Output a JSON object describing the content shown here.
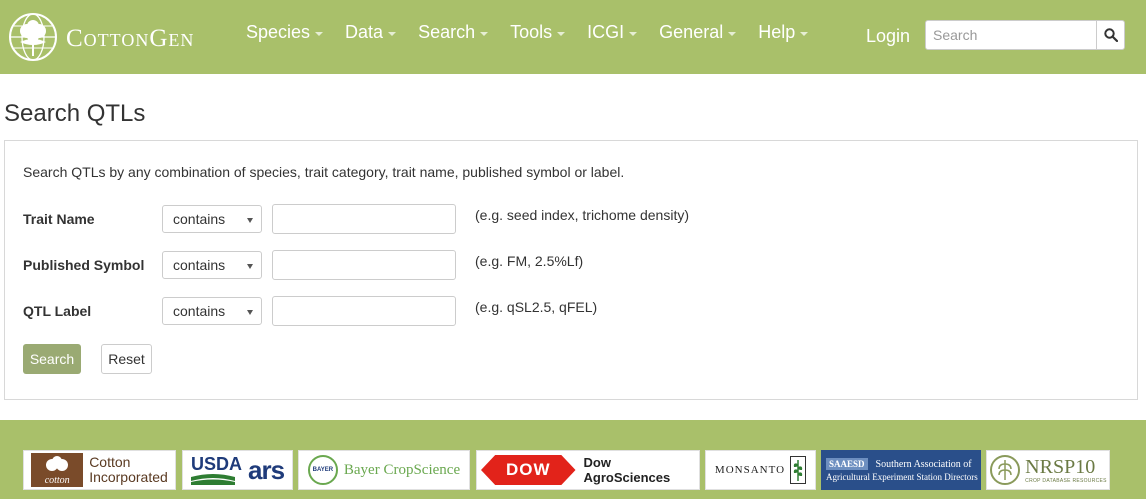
{
  "header": {
    "site_name": "CottonGen",
    "nav": [
      {
        "label": "Species"
      },
      {
        "label": "Data"
      },
      {
        "label": "Search"
      },
      {
        "label": "Tools"
      },
      {
        "label": "ICGI"
      },
      {
        "label": "General"
      },
      {
        "label": "Help"
      }
    ],
    "login_label": "Login",
    "search_placeholder": "Search"
  },
  "page": {
    "title": "Search QTLs",
    "description": "Search QTLs by any combination of species, trait category, trait name, published symbol or label.",
    "rows": [
      {
        "label": "Trait Name",
        "operator": "contains",
        "value": "",
        "example": "(e.g. seed index, trichome density)"
      },
      {
        "label": "Published Symbol",
        "operator": "contains",
        "value": "",
        "example": "(e.g. FM, 2.5%Lf)"
      },
      {
        "label": "QTL Label",
        "operator": "contains",
        "value": "",
        "example": "(e.g. qSL2.5, qFEL)"
      }
    ],
    "search_button": "Search",
    "reset_button": "Reset"
  },
  "footer": {
    "sponsors": {
      "cotton_inc": {
        "line1": "Cotton",
        "line2": "Incorporated",
        "badge": "cotton"
      },
      "usda": {
        "line1": "USDA",
        "line2": "ars"
      },
      "bayer": {
        "badge": "BAYER",
        "label": "Bayer CropScience"
      },
      "dow": {
        "badge": "DOW",
        "label": "Dow AgroSciences"
      },
      "monsanto": {
        "label": "MONSANTO"
      },
      "saaesd": {
        "badge": "SAAESD",
        "line1": "Southern Association of",
        "line2": "Agricultural Experiment Station Directors"
      },
      "nrsp10": {
        "label": "NRSP10",
        "sub": "CROP DATABASE RESOURCES"
      }
    }
  },
  "colors": {
    "header_bg": "#a9c06a",
    "search_button_bg": "#9aaa73",
    "dow_red": "#e2231a",
    "usda_blue": "#1f3b7a",
    "usda_green": "#2e7d32",
    "bayer_green": "#6aa84f",
    "saaesd_blue": "#2a4f8a"
  },
  "icons": {
    "logo": "cotton-boll-globe-icon",
    "search": "magnifier-icon",
    "dropdown": "chevron-down-icon"
  }
}
